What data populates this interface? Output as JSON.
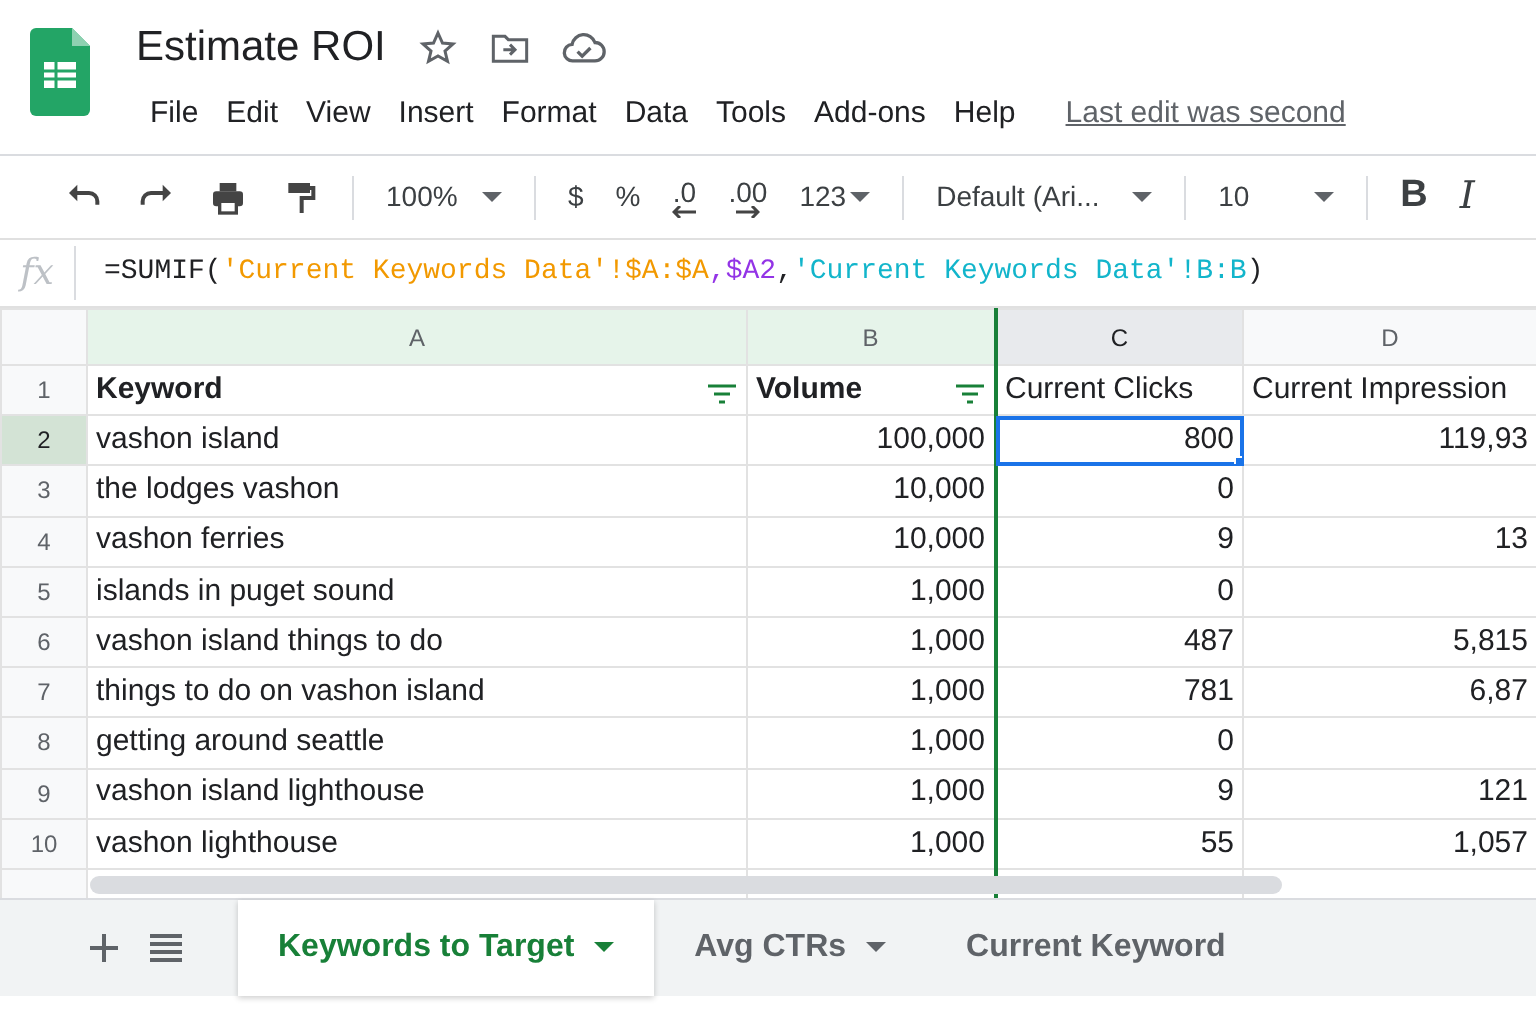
{
  "title": "Estimate ROI",
  "menu": [
    "File",
    "Edit",
    "View",
    "Insert",
    "Format",
    "Data",
    "Tools",
    "Add-ons",
    "Help"
  ],
  "last_edit": "Last edit was second",
  "toolbar": {
    "zoom": "100%",
    "format_buttons": [
      "$",
      "%",
      ".0",
      ".00",
      "123"
    ],
    "font": "Default (Ari...",
    "font_size": "10",
    "style_buttons": [
      "B",
      "I"
    ]
  },
  "formula_bar": {
    "label": "fx",
    "segments": [
      {
        "text": "=SUMIF(",
        "kind": "plain"
      },
      {
        "text": "'Current Keywords Data'!$A:$A",
        "kind": "range1"
      },
      {
        "text": ",$A2",
        "kind": "range2"
      },
      {
        "text": ",",
        "kind": "plain"
      },
      {
        "text": "'Current Keywords Data'!B:B",
        "kind": "range3"
      },
      {
        "text": ")",
        "kind": "plain"
      }
    ]
  },
  "columns": [
    {
      "letter": "A",
      "header": "Keyword",
      "filtered": true,
      "selected": false
    },
    {
      "letter": "B",
      "header": "Volume",
      "filtered": true,
      "selected": false
    },
    {
      "letter": "C",
      "header": "Current Clicks",
      "filtered": false,
      "selected": true
    },
    {
      "letter": "D",
      "header": "Current Impression",
      "filtered": false,
      "selected": false
    }
  ],
  "header_row_number": "1",
  "rows": [
    {
      "number": "2",
      "selected": true,
      "cells": [
        "vashon island",
        "100,000",
        "800",
        "119,93"
      ]
    },
    {
      "number": "3",
      "selected": false,
      "cells": [
        "the lodges vashon",
        "10,000",
        "0",
        ""
      ]
    },
    {
      "number": "4",
      "selected": false,
      "cells": [
        "vashon ferries",
        "10,000",
        "9",
        "13"
      ]
    },
    {
      "number": "5",
      "selected": false,
      "cells": [
        "islands in puget sound",
        "1,000",
        "0",
        ""
      ]
    },
    {
      "number": "6",
      "selected": false,
      "cells": [
        "vashon island things to do",
        "1,000",
        "487",
        "5,815"
      ]
    },
    {
      "number": "7",
      "selected": false,
      "cells": [
        "things to do on vashon island",
        "1,000",
        "781",
        "6,87"
      ]
    },
    {
      "number": "8",
      "selected": false,
      "cells": [
        "getting around seattle",
        "1,000",
        "0",
        ""
      ]
    },
    {
      "number": "9",
      "selected": false,
      "cells": [
        "vashon island lighthouse",
        "1,000",
        "9",
        "121"
      ]
    },
    {
      "number": "10",
      "selected": false,
      "cells": [
        "vashon lighthouse",
        "1,000",
        "55",
        "1,057"
      ]
    }
  ],
  "sheet_tabs": [
    {
      "label": "Keywords to Target",
      "selected": true,
      "menu": true
    },
    {
      "label": "Avg CTRs",
      "selected": false,
      "menu": true
    },
    {
      "label": "Current Keyword",
      "selected": false,
      "menu": false
    }
  ]
}
